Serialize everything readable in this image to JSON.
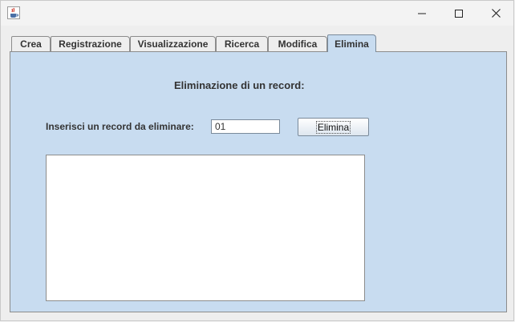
{
  "window": {
    "app_icon": "java-cup-icon",
    "controls": [
      "minimize-icon",
      "maximize-icon",
      "close-icon"
    ]
  },
  "tabs": [
    {
      "label": "Crea",
      "active": false
    },
    {
      "label": "Registrazione",
      "active": false
    },
    {
      "label": "Visualizzazione",
      "active": false
    },
    {
      "label": "Ricerca",
      "active": false
    },
    {
      "label": "Modifica",
      "active": false
    },
    {
      "label": "Elimina",
      "active": true
    }
  ],
  "panel": {
    "heading": "Eliminazione di un record:",
    "input_label": "Inserisci un record da eliminare:",
    "input_value": "01",
    "button_label": "Elimina",
    "result_text": ""
  },
  "colors": {
    "panel_background": "#c8dcf0",
    "window_background": "#eeeeee"
  }
}
